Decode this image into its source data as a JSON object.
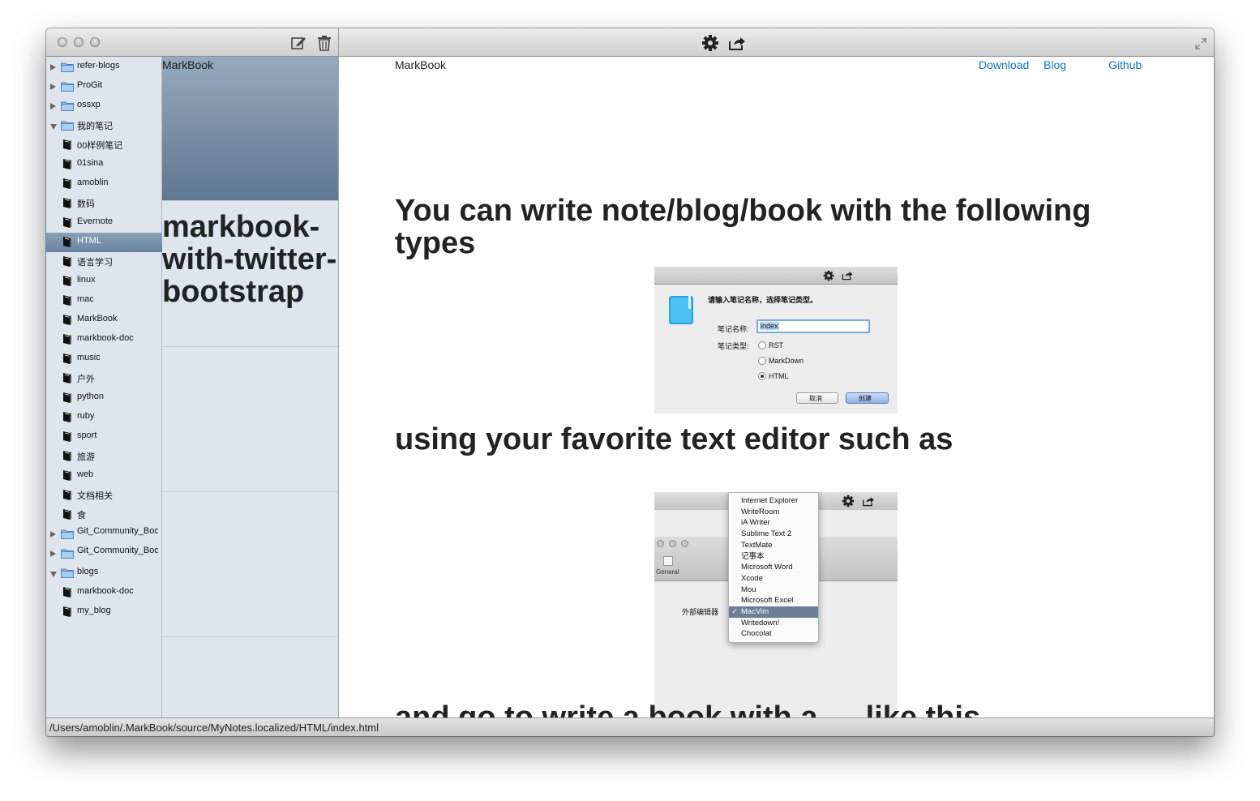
{
  "app": {
    "title": "MarkBook"
  },
  "sidebar": {
    "items": [
      {
        "label": "refer-blogs",
        "kind": "folder",
        "state": "closed"
      },
      {
        "label": "ProGit",
        "kind": "folder",
        "state": "closed"
      },
      {
        "label": "ossxp",
        "kind": "folder",
        "state": "closed"
      },
      {
        "label": "我的笔记",
        "kind": "folder",
        "state": "open"
      },
      {
        "label": "00样例笔记",
        "kind": "note"
      },
      {
        "label": "01sina",
        "kind": "note"
      },
      {
        "label": "amoblin",
        "kind": "note"
      },
      {
        "label": "数码",
        "kind": "note"
      },
      {
        "label": "Evernote",
        "kind": "note"
      },
      {
        "label": "HTML",
        "kind": "note",
        "selected": true
      },
      {
        "label": "语言学习",
        "kind": "note"
      },
      {
        "label": "linux",
        "kind": "note"
      },
      {
        "label": "mac",
        "kind": "note"
      },
      {
        "label": "MarkBook",
        "kind": "note"
      },
      {
        "label": "markbook-doc",
        "kind": "note"
      },
      {
        "label": "music",
        "kind": "note"
      },
      {
        "label": "户外",
        "kind": "note"
      },
      {
        "label": "python",
        "kind": "note"
      },
      {
        "label": "ruby",
        "kind": "note"
      },
      {
        "label": "sport",
        "kind": "note"
      },
      {
        "label": "旅游",
        "kind": "note"
      },
      {
        "label": "web",
        "kind": "note"
      },
      {
        "label": "文档相关",
        "kind": "note"
      },
      {
        "label": "食",
        "kind": "note"
      },
      {
        "label": "Git_Community_Book_zh_CN",
        "kind": "folder",
        "state": "closed",
        "wrap": true
      },
      {
        "label": "Git_Community_Book",
        "kind": "folder",
        "state": "closed",
        "wrap": true
      },
      {
        "label": "blogs",
        "kind": "folder",
        "state": "open"
      },
      {
        "label": "markbook-doc",
        "kind": "note"
      },
      {
        "label": "my_blog",
        "kind": "note"
      }
    ]
  },
  "notelist": {
    "first_title": "MarkBook",
    "big_title": "markbook-with-twitter-bootstrap"
  },
  "preview": {
    "brand": "MarkBook",
    "nav": [
      "Download",
      "Blog",
      "Github"
    ],
    "heading1": "You can write note/blog/book with the following types",
    "heading2": "using your favorite text editor such as",
    "heading3_cut": "and go to write a book with a … like this",
    "dialog": {
      "prompt": "请输入笔记名称，选择笔记类型。",
      "name_label": "笔记名称:",
      "name_value": "index",
      "type_label": "笔记类型:",
      "types": [
        "RST",
        "MarkDown",
        "HTML"
      ],
      "selected_type": "HTML",
      "cancel": "取消",
      "create": "创建"
    },
    "editor_menu": {
      "general_label": "General",
      "external_editor_label": "外部编辑器",
      "options": [
        "Internet Explorer",
        "WriteRoom",
        "iA Writer",
        "Sublime Text 2",
        "TextMate",
        "记事本",
        "Microsoft Word",
        "Xcode",
        "Mou",
        "Microsoft Excel",
        "MacVim",
        "Writedown!",
        "Chocolat"
      ],
      "selected": "MacVim"
    }
  },
  "statusbar": {
    "path": "/Users/amoblin/.MarkBook/source/MyNotes.localized/HTML/index.html"
  },
  "colors": {
    "accent_link": "#0b74c9",
    "selection": "#6a849f"
  }
}
